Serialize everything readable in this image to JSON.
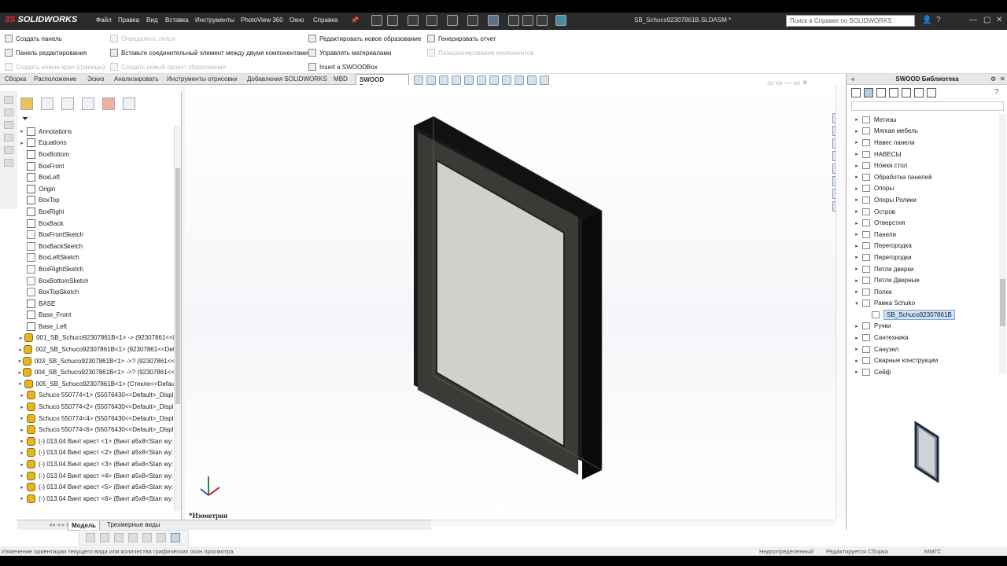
{
  "app": {
    "logo": "SOLIDWORKS",
    "logo_mark": "3S",
    "document_title": "SB_Schuco92307861B.SLDASM *"
  },
  "menu": [
    "Файл",
    "Правка",
    "Вид",
    "Вставка",
    "Инструменты",
    "PhotoView 360",
    "Окно",
    "Справка"
  ],
  "search": {
    "placeholder": "Поиск в Справке по SOLIDWORKS"
  },
  "commands": {
    "col1": [
      "Создать панель",
      "Панель редактирования",
      "Создать новые края (границы)"
    ],
    "col2": [
      "Определить литья",
      "Вставьте соединительный элемент между двумя компонентами",
      "Создать новый проект образования"
    ],
    "col3": [
      "Редактировать новое образование",
      "Управлять материалами",
      "Insert a SWOODBox"
    ],
    "col4": [
      "Генерировать отчет",
      "Позиционирование компонентов"
    ]
  },
  "tabs": [
    "Сборка",
    "Расположение",
    "Эскиз",
    "Анализировать",
    "Инструменты отрисовки",
    "Добавления SOLIDWORKS",
    "MBD",
    "SWOOD Design"
  ],
  "active_tab": "SWOOD Design",
  "tree": [
    {
      "label": "Annotations",
      "icon": "annotations-icon",
      "arrow": "▸"
    },
    {
      "label": "Equations",
      "icon": "equations-icon",
      "arrow": "▸"
    },
    {
      "label": "BoxBottom",
      "icon": "plane-icon",
      "arrow": ""
    },
    {
      "label": "BoxFront",
      "icon": "plane-icon",
      "arrow": ""
    },
    {
      "label": "BoxLeft",
      "icon": "plane-icon",
      "arrow": ""
    },
    {
      "label": "Origin",
      "icon": "origin-icon",
      "arrow": ""
    },
    {
      "label": "BoxTop",
      "icon": "plane-icon",
      "arrow": ""
    },
    {
      "label": "BoxRight",
      "icon": "plane-icon",
      "arrow": ""
    },
    {
      "label": "BoxBack",
      "icon": "plane-icon",
      "arrow": ""
    },
    {
      "label": "BoxFrontSketch",
      "icon": "sketch-icon",
      "arrow": ""
    },
    {
      "label": "BoxBackSketch",
      "icon": "sketch-icon",
      "arrow": ""
    },
    {
      "label": "BoxLeftSketch",
      "icon": "sketch-icon",
      "arrow": ""
    },
    {
      "label": "BoxRightSketch",
      "icon": "sketch-icon",
      "arrow": ""
    },
    {
      "label": "BoxBottomSketch",
      "icon": "sketch-icon",
      "arrow": ""
    },
    {
      "label": "BoxTopSketch",
      "icon": "sketch-icon",
      "arrow": ""
    },
    {
      "label": "BASE",
      "icon": "plane-icon",
      "arrow": ""
    },
    {
      "label": "Base_Front",
      "icon": "plane-icon",
      "arrow": ""
    },
    {
      "label": "Base_Left",
      "icon": "plane-icon",
      "arrow": ""
    },
    {
      "label": "001_SB_Schuco92307861B<1> -> (92307861<<I",
      "icon": "part-icon",
      "arrow": "▸"
    },
    {
      "label": "002_SB_Schuco92307861B<1> (92307861<<Def",
      "icon": "part-icon",
      "arrow": "▸"
    },
    {
      "label": "003_SB_Schuco92307861B<1> ->? (92307861<<",
      "icon": "part-icon",
      "arrow": "▸"
    },
    {
      "label": "004_SB_Schuco92307861B<1> ->? (92307861<<",
      "icon": "part-icon",
      "arrow": "▸"
    },
    {
      "label": "005_SB_Schuco92307861B<1> (Стекло<<Defau",
      "icon": "part-icon",
      "arrow": "▸"
    },
    {
      "label": "Schuco 550774<1> (55076430<<Default>_Displ",
      "icon": "part-icon",
      "arrow": "▸"
    },
    {
      "label": "Schuco 550774<2> (55076430<<Default>_Displ",
      "icon": "part-icon",
      "arrow": "▸"
    },
    {
      "label": "Schuco 550774<4> (55076430<<Default>_Displ",
      "icon": "part-icon",
      "arrow": "▸"
    },
    {
      "label": "Schuco 550774<6> (55076430<<Default>_Displ",
      "icon": "part-icon",
      "arrow": "▸"
    },
    {
      "label": "(-) 013.04 Винт крест <1> (Винт ø5x8<Stan wy:",
      "icon": "part-icon",
      "arrow": "▸"
    },
    {
      "label": "(-) 013.04 Винт крест <2> (Винт ø5x8<Stan wy:",
      "icon": "part-icon",
      "arrow": "▸"
    },
    {
      "label": "(-) 013.04 Винт крест <3> (Винт ø5x8<Stan wy:",
      "icon": "part-icon",
      "arrow": "▸"
    },
    {
      "label": "(-) 013.04 Винт крест <4> (Винт ø5x8<Stan wy:",
      "icon": "part-icon",
      "arrow": "▸"
    },
    {
      "label": "(-) 013.04 Винт крест <5> (Винт ø5x8<Stan wy:",
      "icon": "part-icon",
      "arrow": "▸"
    },
    {
      "label": "(-) 013.04 Винт крест <6> (Винт ø5x8<Stan wy:",
      "icon": "part-icon",
      "arrow": "▸"
    }
  ],
  "viewport": {
    "view_name": "*Изометрия"
  },
  "bottom_tabs": [
    "Модель",
    "Трехмерные виды"
  ],
  "right_panel": {
    "title": "SWOOD Библиотека",
    "items": [
      {
        "label": "Метизы",
        "arrow": "▸"
      },
      {
        "label": "Мягкая мебель",
        "arrow": "▸"
      },
      {
        "label": "Навес панели",
        "arrow": "▸"
      },
      {
        "label": "НАВЕСЫ",
        "arrow": "▸"
      },
      {
        "label": "Ножки стол",
        "arrow": "▸"
      },
      {
        "label": "Обработка панелей",
        "arrow": "▸"
      },
      {
        "label": "Опоры",
        "arrow": "▸"
      },
      {
        "label": "Опоры Ролики",
        "arrow": "▸"
      },
      {
        "label": "Остров",
        "arrow": "▸"
      },
      {
        "label": "Отверстия",
        "arrow": "▸"
      },
      {
        "label": "Панели",
        "arrow": "▸"
      },
      {
        "label": "Перегородка",
        "arrow": "▸"
      },
      {
        "label": "Перегородки",
        "arrow": "▸"
      },
      {
        "label": "Петли дверки",
        "arrow": "▸"
      },
      {
        "label": "Петли Дверные",
        "arrow": "▸"
      },
      {
        "label": "Полки",
        "arrow": "▸"
      },
      {
        "label": "Рамка Schuko",
        "arrow": "▾"
      },
      {
        "label": "SB_Schuco92307861B",
        "arrow": "",
        "selected": true
      },
      {
        "label": "Ручки",
        "arrow": "▸"
      },
      {
        "label": "Сантехника",
        "arrow": "▸"
      },
      {
        "label": "Санузел",
        "arrow": "▸"
      },
      {
        "label": "Сварные конструкции",
        "arrow": "▸"
      },
      {
        "label": "Сейф",
        "arrow": "▸"
      }
    ]
  },
  "status": {
    "left": "Изменение ориентации текущего вида или количества графических окон просмотра.",
    "def": "Недоопределенный",
    "edit": "Редактируется Сборка",
    "units": "ММГС"
  }
}
